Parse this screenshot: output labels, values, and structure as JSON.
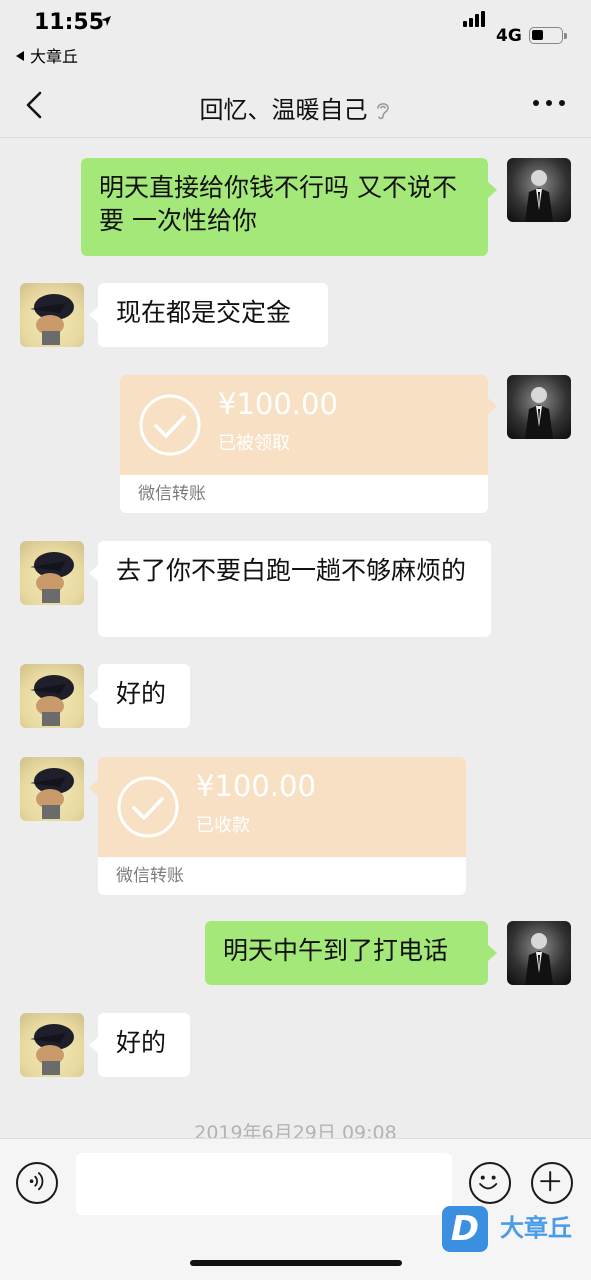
{
  "status_bar": {
    "time": "11:55",
    "back_app": "大章丘",
    "network": "4G"
  },
  "nav": {
    "title": "回忆、温暖自己"
  },
  "messages": [
    {
      "side": "right",
      "type": "text",
      "text": "明天直接给你钱不行吗  又不说不要  一次性给你"
    },
    {
      "side": "left",
      "type": "text",
      "text": "现在都是交定金"
    },
    {
      "side": "right",
      "type": "transfer",
      "amount": "¥100.00",
      "status": "已被领取",
      "footer": "微信转账"
    },
    {
      "side": "left",
      "type": "text",
      "text": "去了你不要白跑一趟不够麻烦的"
    },
    {
      "side": "left",
      "type": "text",
      "text": "好的"
    },
    {
      "side": "left",
      "type": "transfer",
      "amount": "¥100.00",
      "status": "已收款",
      "footer": "微信转账"
    },
    {
      "side": "right",
      "type": "text",
      "text": "明天中午到了打电话"
    },
    {
      "side": "left",
      "type": "text",
      "text": "好的"
    }
  ],
  "timestamp": "2019年6月29日 09:08",
  "watermark": {
    "logo": "D",
    "text": "大章丘"
  },
  "colors": {
    "background": "#ededed",
    "sent_bubble": "#a5e87a",
    "received_bubble": "#ffffff",
    "transfer_card": "#f7e0c3"
  },
  "icons": [
    "location-arrow-icon",
    "signal-icon",
    "battery-icon",
    "back-chevron-icon",
    "ear-icon",
    "more-icon",
    "check-circle-icon",
    "voice-icon",
    "emoji-icon",
    "plus-icon"
  ]
}
